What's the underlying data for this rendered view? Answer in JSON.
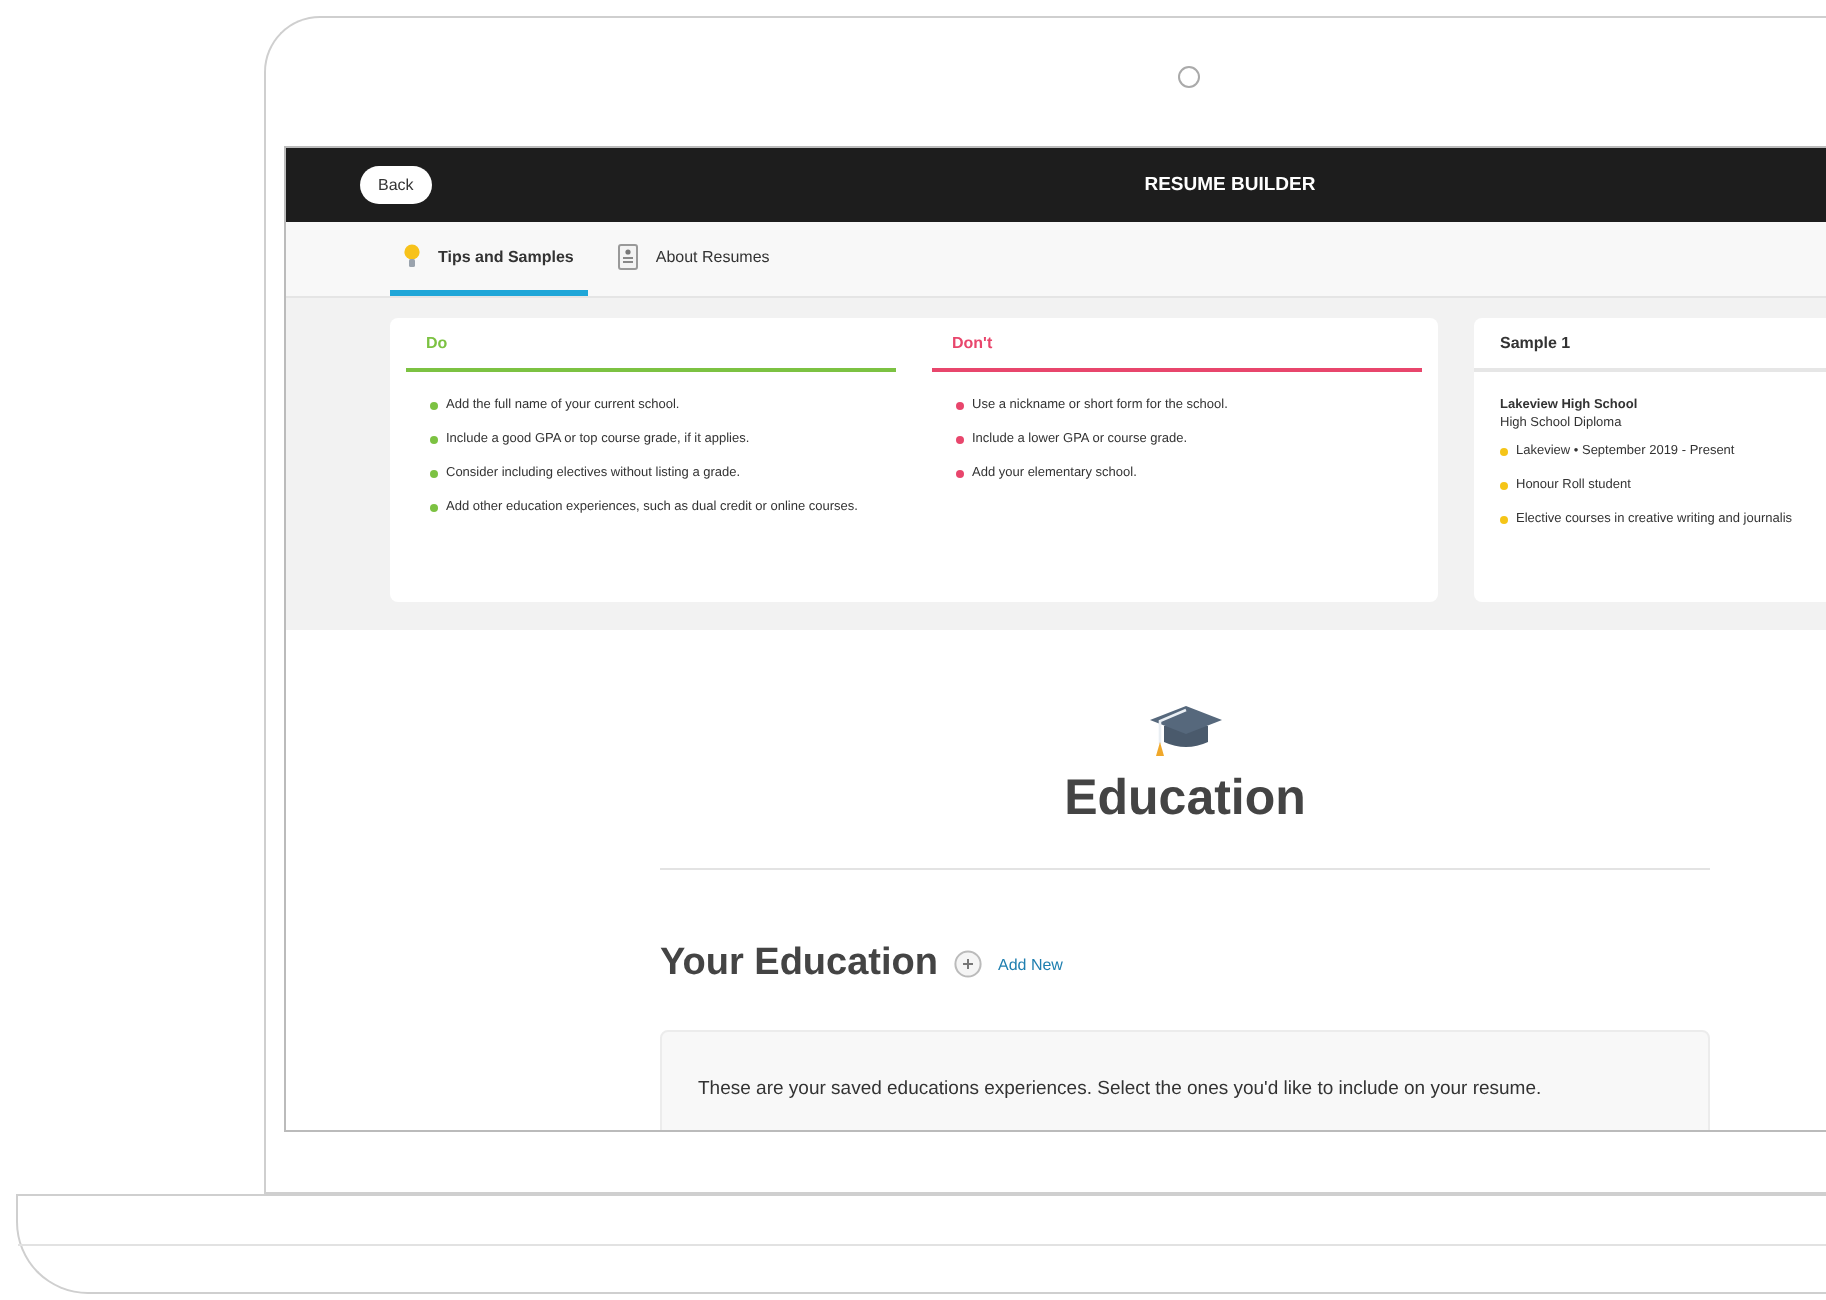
{
  "header": {
    "back_button": "Back",
    "title": "RESUME BUILDER"
  },
  "tabs": [
    {
      "kind": "tips",
      "label": "Tips and Samples",
      "selected": true
    },
    {
      "kind": "about",
      "label": "About Resumes",
      "selected": false
    }
  ],
  "tips": [
    {
      "heading": "Do",
      "color": "#7cc242",
      "items": [
        "Add the full name of your current school.",
        "Include a good GPA or top course grade, if it applies.",
        "Consider including electives without listing a grade.",
        "Add other education experiences, such as dual credit or online courses."
      ]
    },
    {
      "heading": "Don't",
      "color": "#e8466c",
      "items": [
        "Use a nickname or short form for the school.",
        "Include a lower GPA or course grade.",
        "Add your elementary school."
      ]
    }
  ],
  "sample": {
    "title": "Sample 1",
    "school": "Lakeview High School",
    "credential": "High School Diploma",
    "items": [
      "Lakeview • September 2019 - Present",
      "Honour Roll student",
      "Elective courses in creative writing and journalis"
    ]
  },
  "section": {
    "title": "Education"
  },
  "your_education": {
    "title": "Your Education",
    "add_link": "Add New",
    "note": "These are your saved educations experiences. Select the ones you'd like to include on your resume."
  }
}
